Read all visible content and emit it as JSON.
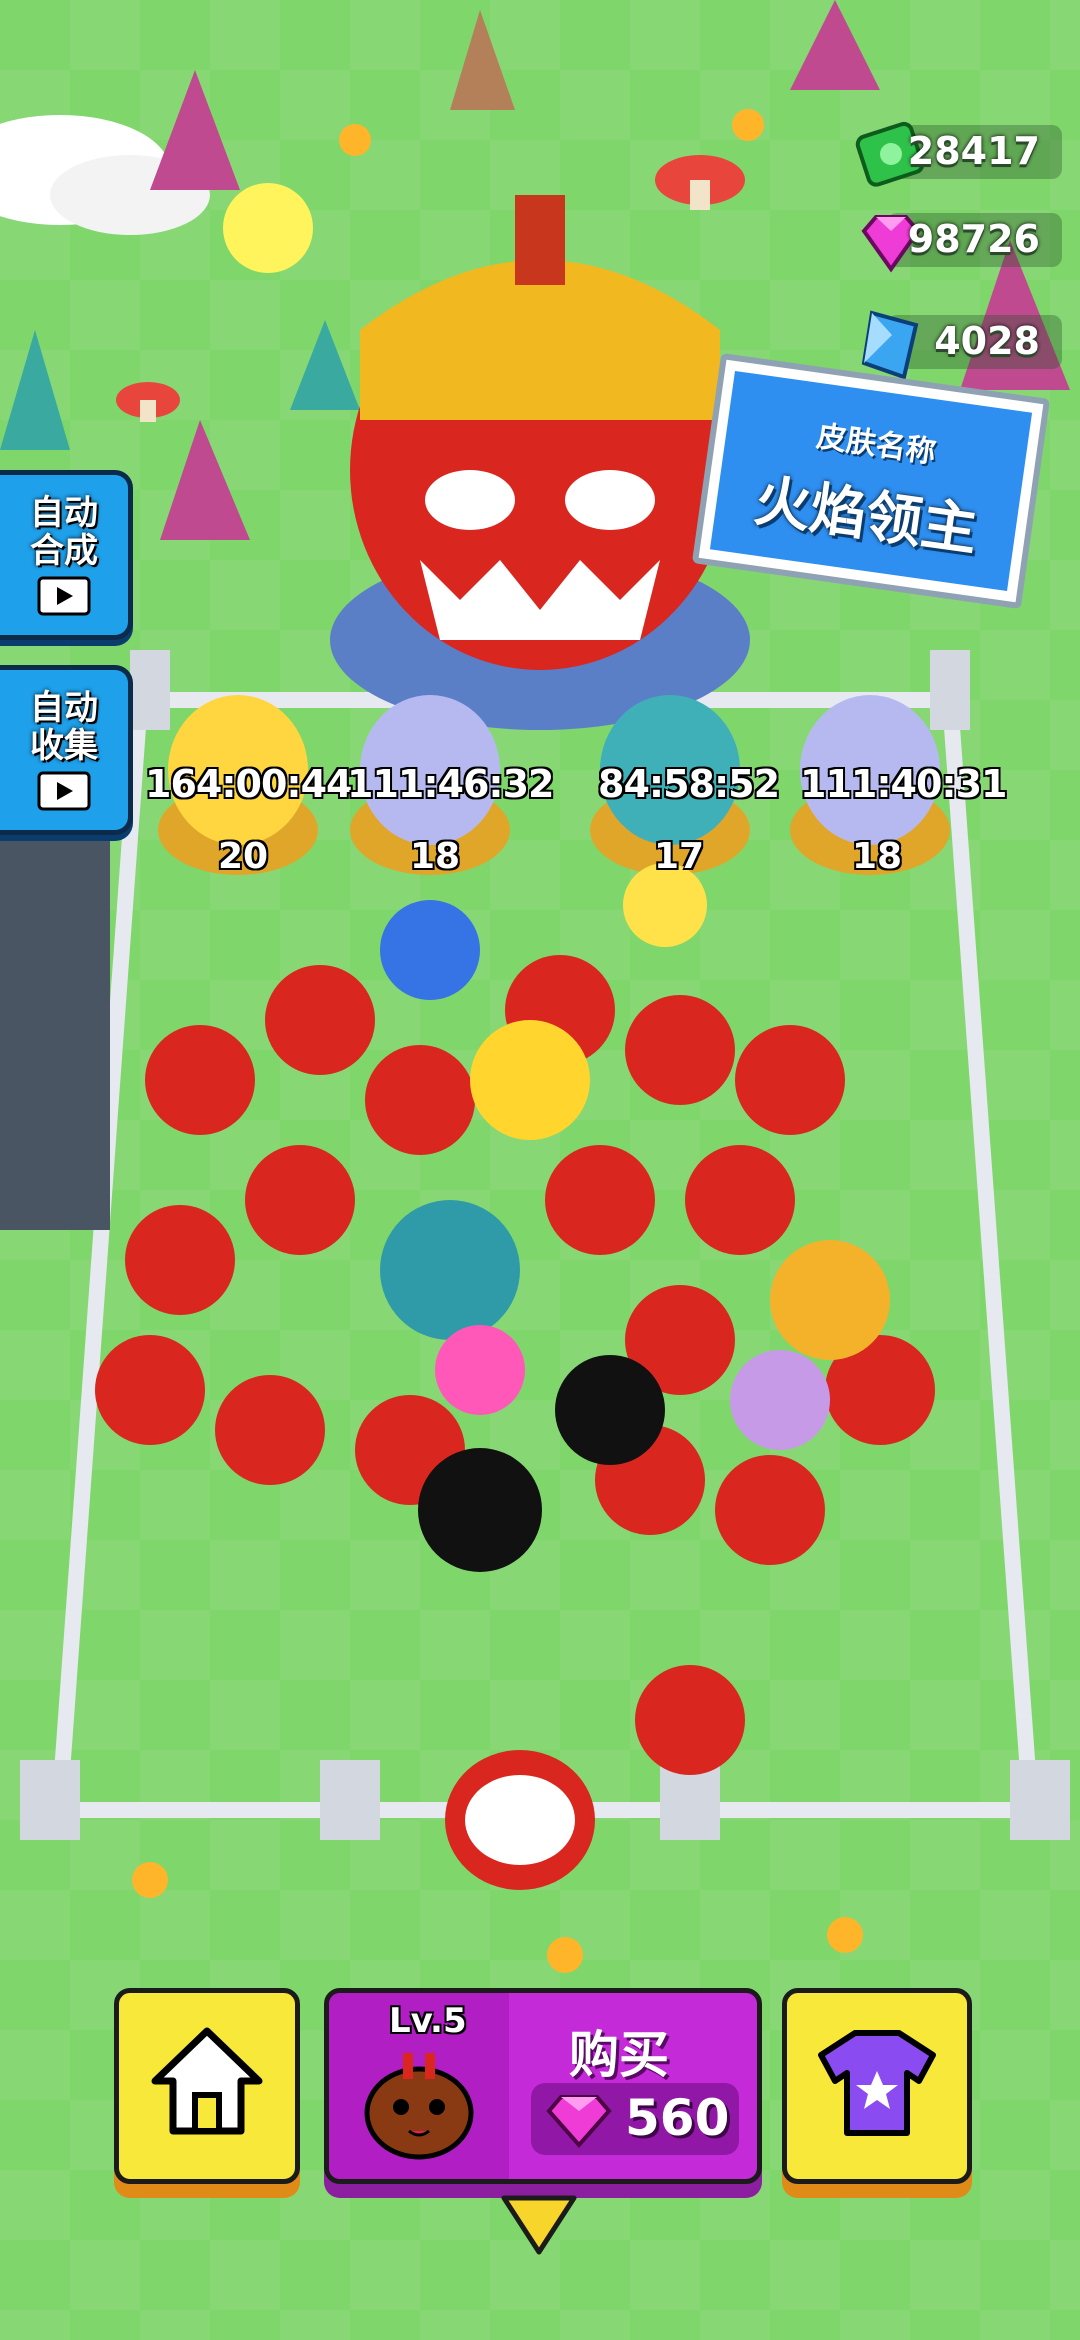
{
  "currencies": {
    "cash": "28417",
    "gems": "98726",
    "crystals": "4028"
  },
  "side_buttons": {
    "auto_merge": "自动\n合成",
    "auto_collect": "自动\n收集"
  },
  "skin_sign": {
    "label": "皮肤名称",
    "name": "火焰领主"
  },
  "eggs": [
    {
      "timer": "164:00:44",
      "level": "20"
    },
    {
      "timer": "111:46:32",
      "level": "18"
    },
    {
      "timer": "84:58:52",
      "level": "17"
    },
    {
      "timer": "111:40:31",
      "level": "18"
    }
  ],
  "buy_panel": {
    "level": "Lv.5",
    "buy_label": "购买",
    "price": "560"
  },
  "colors": {
    "grass": "#7fd66b",
    "accent_yellow": "#f8e83a",
    "accent_purple": "#c52ad8",
    "accent_blue": "#1ea0ea"
  }
}
